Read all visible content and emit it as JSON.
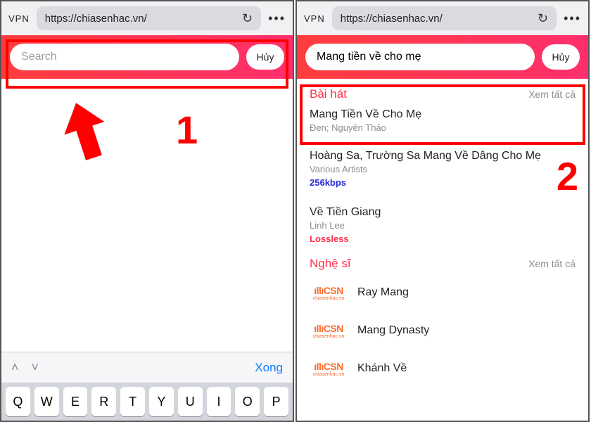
{
  "browser": {
    "vpn": "VPN",
    "url": "https://chiasenhac.vn/",
    "menu": "•••"
  },
  "panel1": {
    "search_placeholder": "Search",
    "search_value": "",
    "cancel": "Hủy",
    "keyboard": {
      "done": "Xong",
      "row": [
        "Q",
        "W",
        "E",
        "R",
        "T",
        "Y",
        "U",
        "I",
        "O",
        "P"
      ]
    },
    "annotation_num": "1"
  },
  "panel2": {
    "search_value": "Mang tiền về cho mẹ",
    "cancel": "Hủy",
    "songs_header": "Bài hát",
    "see_all": "Xem tất cả",
    "songs": [
      {
        "title": "Mang Tiền Về Cho Mẹ",
        "artist": "Đen; Nguyên Thảo",
        "bitrate": ""
      },
      {
        "title": "Hoàng Sa, Trường Sa Mang Về Dâng Cho Mẹ",
        "artist": "Various Artists",
        "bitrate": "256kbps",
        "bclass": "blue"
      },
      {
        "title": "Về Tiền Giang",
        "artist": "Linh Lee",
        "bitrate": "Lossless",
        "bclass": "red"
      }
    ],
    "artists_header": "Nghệ sĩ",
    "artists": [
      {
        "name": "Ray Mang"
      },
      {
        "name": "Mang Dynasty"
      },
      {
        "name": "Khánh Về"
      }
    ],
    "logo_top": "ıllıCSN",
    "logo_bot": "chiasenhac.vn",
    "annotation_num": "2"
  }
}
